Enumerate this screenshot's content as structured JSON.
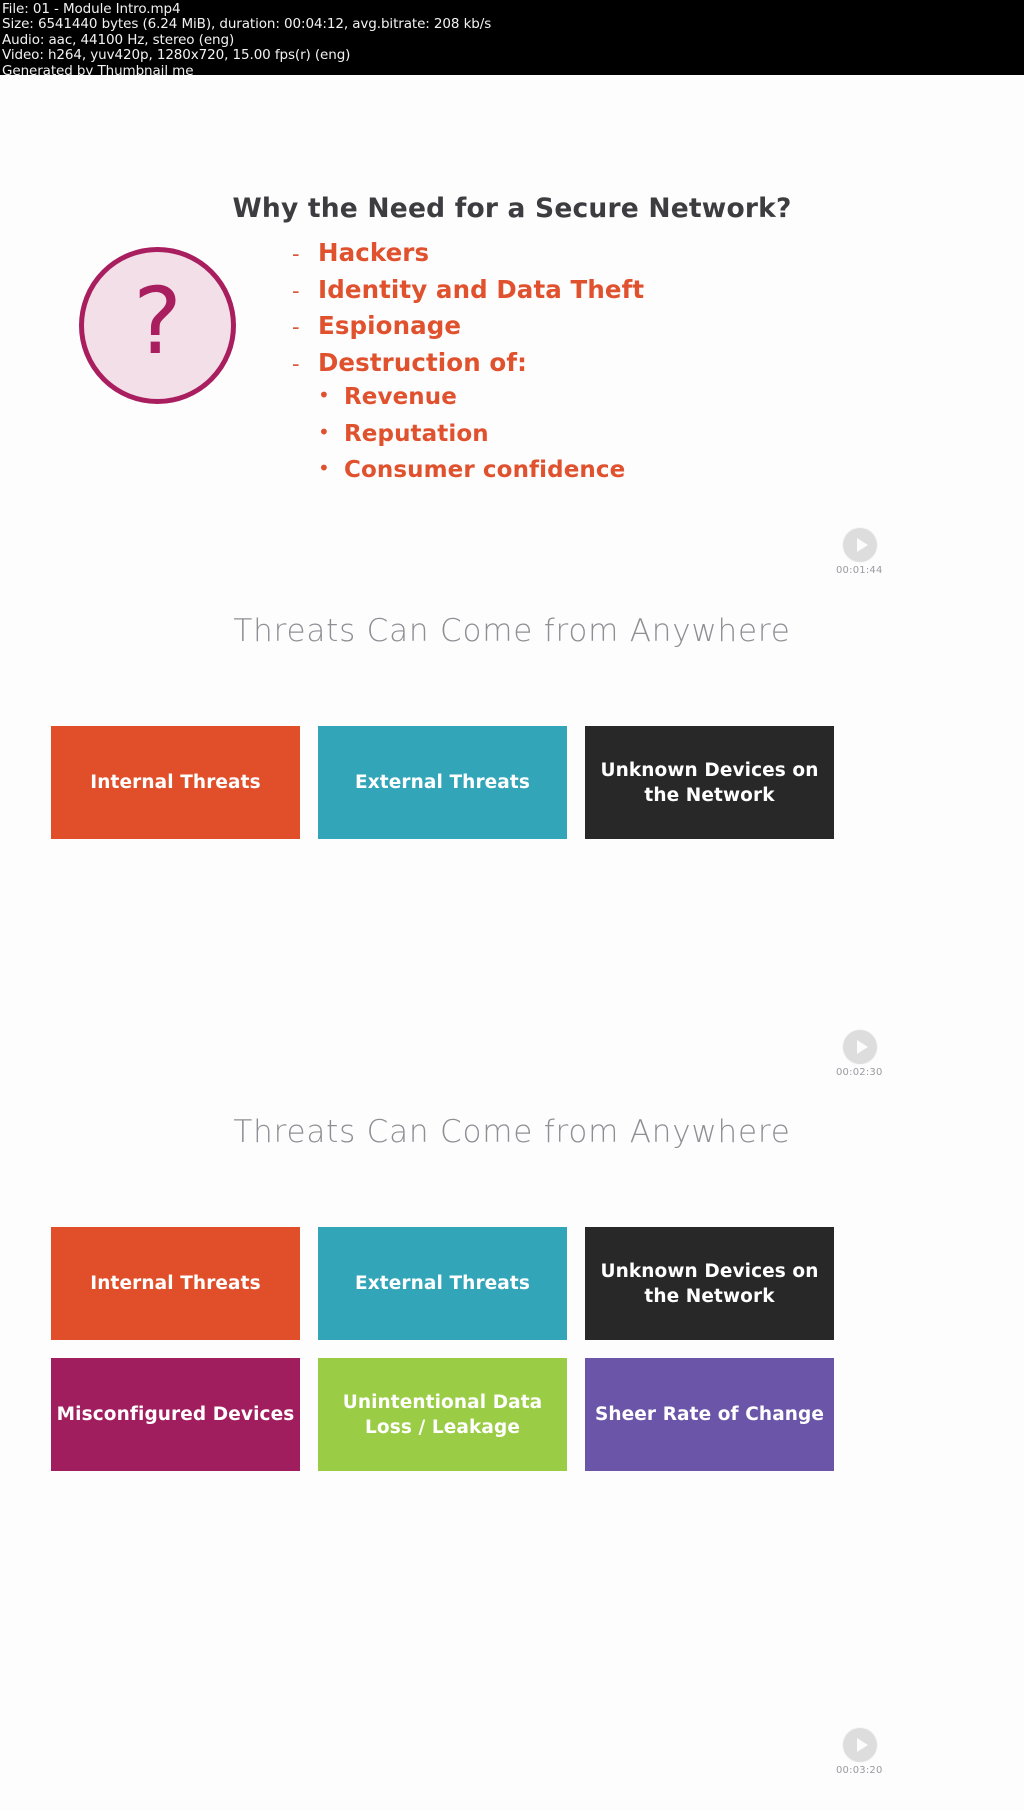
{
  "file_info": {
    "lines": [
      "File: 01 - Module Intro.mp4",
      "Size: 6541440 bytes (6.24 MiB), duration: 00:04:12, avg.bitrate: 208 kb/s",
      "Audio: aac, 44100 Hz, stereo (eng)",
      "Video: h264, yuv420p, 1280x720, 15.00 fps(r) (eng)",
      "Generated by Thumbnail me"
    ]
  },
  "slides": {
    "slide1": {
      "title": "Why the Need for a Secure Network?",
      "icon_glyph": "?",
      "icon_color": "#a81e5e",
      "icon_fill": "#f2dfe7",
      "text_color": "#e0512e",
      "bullets": [
        {
          "marker": "-",
          "label": "Hackers",
          "level": 1
        },
        {
          "marker": "-",
          "label": "Identity and Data Theft",
          "level": 1
        },
        {
          "marker": "-",
          "label": "Espionage",
          "level": 1
        },
        {
          "marker": "-",
          "label": "Destruction of:",
          "level": 1
        },
        {
          "marker": "•",
          "label": "Revenue",
          "level": 2
        },
        {
          "marker": "•",
          "label": "Reputation",
          "level": 2
        },
        {
          "marker": "•",
          "label": "Consumer confidence",
          "level": 2
        }
      ],
      "timestamp": "00:01:44"
    },
    "slide2": {
      "title": "Threats Can Come from Anywhere",
      "tiles": [
        {
          "label": "Internal Threats",
          "color": "#e04e2a"
        },
        {
          "label": "External Threats",
          "color": "#32a5b8"
        },
        {
          "label": "Unknown Devices on the Network",
          "color": "#282828"
        }
      ],
      "timestamp": "00:02:30"
    },
    "slide3": {
      "title": "Threats Can Come from Anywhere",
      "tiles": [
        {
          "label": "Internal Threats",
          "color": "#e04e2a"
        },
        {
          "label": "External Threats",
          "color": "#32a5b8"
        },
        {
          "label": "Unknown Devices on the Network",
          "color": "#282828"
        },
        {
          "label": "Misconfigured Devices",
          "color": "#a01e5e"
        },
        {
          "label": "Unintentional Data Loss / Leakage",
          "color": "#9acd45"
        },
        {
          "label": "Sheer Rate of Change",
          "color": "#6a55a8"
        }
      ],
      "timestamp": "00:03:20"
    }
  }
}
